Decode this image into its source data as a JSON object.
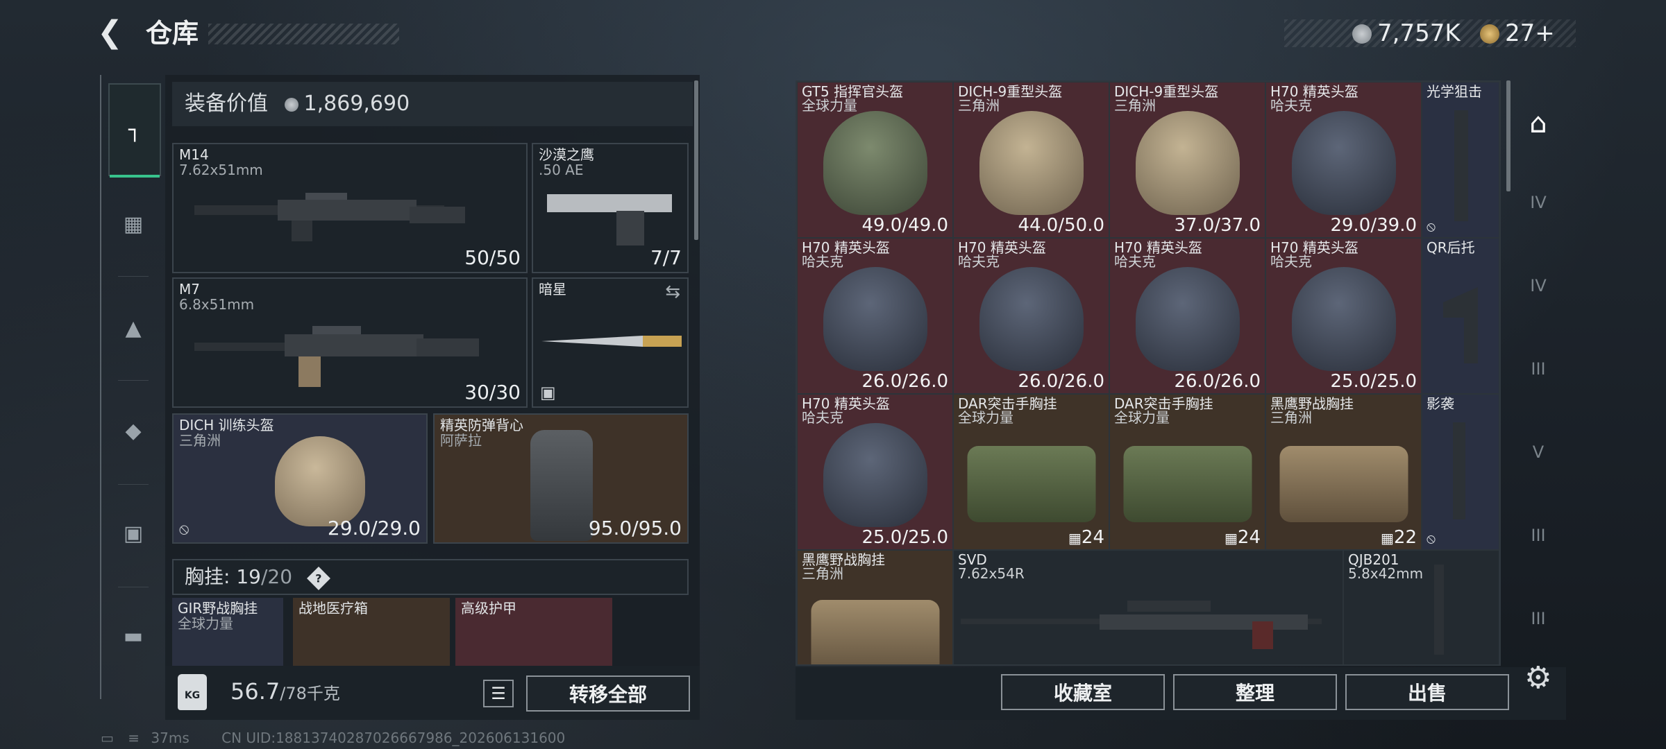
{
  "header": {
    "title": "仓库",
    "currency_1": "7,757K",
    "currency_2": "27+"
  },
  "equipment": {
    "value_label": "装备价值",
    "value": "1,869,690",
    "slots": [
      {
        "name": "M14",
        "sub": "7.62x51mm",
        "dur": "50/50"
      },
      {
        "name": "沙漠之鹰",
        "sub": ".50 AE",
        "dur": "7/7"
      },
      {
        "name": "M7",
        "sub": "6.8x51mm",
        "dur": "30/30"
      },
      {
        "name": "暗星",
        "sub": "",
        "dur": ""
      },
      {
        "name": "DICH 训练头盔",
        "sub": "三角洲",
        "dur": "29.0/29.0"
      },
      {
        "name": "精英防弹背心",
        "sub": "阿萨拉",
        "dur": "95.0/95.0"
      }
    ],
    "chest_label": "胸挂:",
    "chest_used": "19",
    "chest_total": "/20",
    "chest_help": "?",
    "chest_items": [
      {
        "name": "GIR野战胸挂",
        "sub": "全球力量"
      },
      {
        "name": "战地医疗箱",
        "sub": ""
      },
      {
        "name": "高级护甲",
        "sub": ""
      }
    ],
    "weight": "56.7",
    "weight_max": "/78千克",
    "weight_icon": "KG",
    "transfer_all": "转移全部"
  },
  "stash": {
    "cells": [
      {
        "name": "GT5 指挥官头盔",
        "sub": "全球力量",
        "val": "49.0/49.0"
      },
      {
        "name": "DICH-9重型头盔",
        "sub": "三角洲",
        "val": "44.0/50.0"
      },
      {
        "name": "DICH-9重型头盔",
        "sub": "三角洲",
        "val": "37.0/37.0"
      },
      {
        "name": "H70 精英头盔",
        "sub": "哈夫克",
        "val": "29.0/39.0"
      },
      {
        "name": "光学狙击",
        "sub": "",
        "val": ""
      },
      {
        "name": "H70 精英头盔",
        "sub": "哈夫克",
        "val": "26.0/26.0"
      },
      {
        "name": "H70 精英头盔",
        "sub": "哈夫克",
        "val": "26.0/26.0"
      },
      {
        "name": "H70 精英头盔",
        "sub": "哈夫克",
        "val": "26.0/26.0"
      },
      {
        "name": "H70 精英头盔",
        "sub": "哈夫克",
        "val": "25.0/25.0"
      },
      {
        "name": "QR后托",
        "sub": "",
        "val": ""
      },
      {
        "name": "H70 精英头盔",
        "sub": "哈夫克",
        "val": "25.0/25.0"
      },
      {
        "name": "DAR突击手胸挂",
        "sub": "全球力量",
        "val": "24"
      },
      {
        "name": "DAR突击手胸挂",
        "sub": "全球力量",
        "val": "24"
      },
      {
        "name": "黑鹰野战胸挂",
        "sub": "三角洲",
        "val": "22"
      },
      {
        "name": "影袭",
        "sub": "",
        "val": ""
      },
      {
        "name": "黑鹰野战胸挂",
        "sub": "三角洲",
        "val": ""
      },
      {
        "name": "SVD",
        "sub": "7.62x54R",
        "val": ""
      },
      {
        "name": "QJB201",
        "sub": "5.8x42mm",
        "val": ""
      }
    ],
    "btn_collection": "收藏室",
    "btn_sort": "整理",
    "btn_sell": "出售"
  },
  "right_nav": [
    "IV",
    "IV",
    "III",
    "V",
    "III",
    "III"
  ],
  "status": {
    "ping": "37ms",
    "uid": "CN UID:18813740287026667986_202606131600"
  },
  "colors": {
    "accent": "#38c38c",
    "rare_red": "#4a2a31",
    "rare_blue": "#2a3042",
    "rare_brown": "#3f3328"
  }
}
